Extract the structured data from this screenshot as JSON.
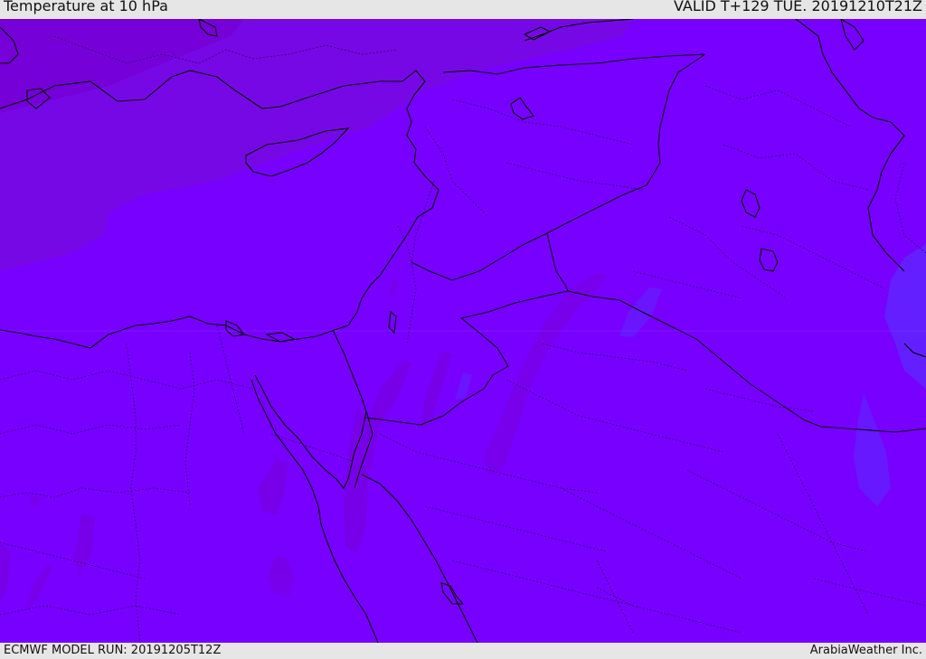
{
  "header": {
    "title": "Temperature at 10 hPa",
    "valid_time": "VALID T+129 TUE. 20191210T21Z"
  },
  "footer": {
    "model_run": "ECMWF MODEL RUN: 20191205T12Z",
    "credit": "ArabiaWeather Inc."
  },
  "map": {
    "colors": {
      "base_field": "#7800ff",
      "cold_region": "#7400d6",
      "mid_region": "#7708e6",
      "warm_patch": "#5a2cff",
      "coastline": "#000000",
      "border_dotted": "#1a0033"
    }
  }
}
